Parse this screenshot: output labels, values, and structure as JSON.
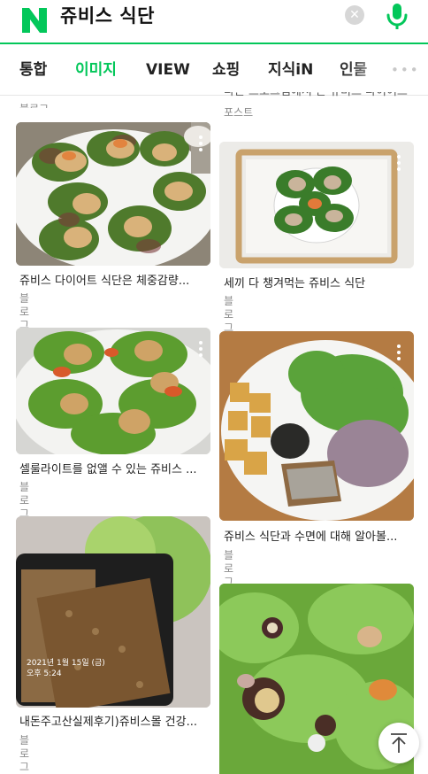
{
  "search": {
    "query": "쥬비스 식단"
  },
  "tabs": [
    "통합",
    "이미지",
    "VIEW",
    "쇼핑",
    "지식iN",
    "인물"
  ],
  "top_partial": {
    "left_source": "블로그",
    "right_title": "다른 프로그램에서 본 쥬비스 다이어트",
    "right_source": "포스트"
  },
  "results": [
    {
      "title": "쥬비스 다이어트 식단은 체중감량...",
      "source": "블로그"
    },
    {
      "title": "세끼 다 챙겨먹는 쥬비스 식단",
      "source": "블로그"
    },
    {
      "title": "셀룰라이트를 없앨 수 있는 쥬비스 ...",
      "source": "블로그"
    },
    {
      "title": "쥬비스 식단과 수면에 대해 알아볼...",
      "source": "블로그"
    },
    {
      "title": "내돈주고산실제후기)쥬비스몰 건강...",
      "source": "블로그"
    }
  ],
  "image_overlays": {
    "card5_stamp_line1": "2021년 1월 15일 (금)",
    "card5_stamp_line2": "오후 5:24"
  },
  "colors": {
    "brand": "#03c75a",
    "tab_active": "#03c75a"
  },
  "icons": [
    "naver-logo-icon",
    "clear-icon",
    "mic-icon",
    "more-dots-icon",
    "more-options-icon",
    "scroll-top-icon"
  ]
}
